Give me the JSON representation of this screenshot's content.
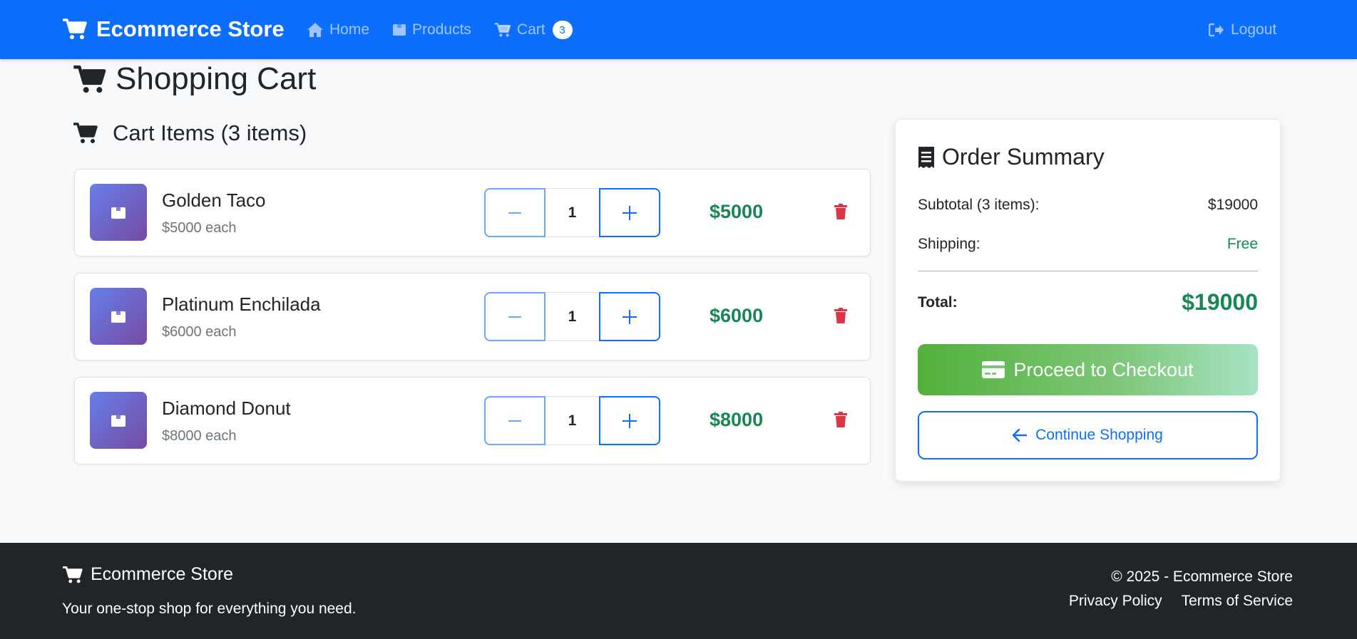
{
  "navbar": {
    "brand": "Ecommerce Store",
    "links": [
      {
        "label": "Home",
        "icon": "home-icon"
      },
      {
        "label": "Products",
        "icon": "box-icon"
      },
      {
        "label": "Cart",
        "icon": "cart-icon",
        "badge": "3"
      }
    ],
    "logout": "Logout"
  },
  "page": {
    "title": "Shopping Cart",
    "section_title": "Cart Items (3 items)"
  },
  "items": [
    {
      "name": "Golden Taco",
      "unit": "$5000 each",
      "qty": "1",
      "total": "$5000"
    },
    {
      "name": "Platinum Enchilada",
      "unit": "$6000 each",
      "qty": "1",
      "total": "$6000"
    },
    {
      "name": "Diamond Donut",
      "unit": "$8000 each",
      "qty": "1",
      "total": "$8000"
    }
  ],
  "summary": {
    "title": "Order Summary",
    "subtotal_label": "Subtotal (3 items):",
    "subtotal_value": "$19000",
    "shipping_label": "Shipping:",
    "shipping_value": "Free",
    "total_label": "Total:",
    "total_value": "$19000",
    "checkout_label": "Proceed to Checkout",
    "continue_label": "Continue Shopping"
  },
  "footer": {
    "brand": "Ecommerce Store",
    "tagline": "Your one-stop shop for everything you need.",
    "copyright": "© 2025 - Ecommerce Store",
    "links": [
      "Privacy Policy",
      "Terms of Service"
    ]
  },
  "colors": {
    "primary": "#0d6efd",
    "success": "#198754",
    "danger": "#dc3545",
    "footer": "#212529"
  }
}
